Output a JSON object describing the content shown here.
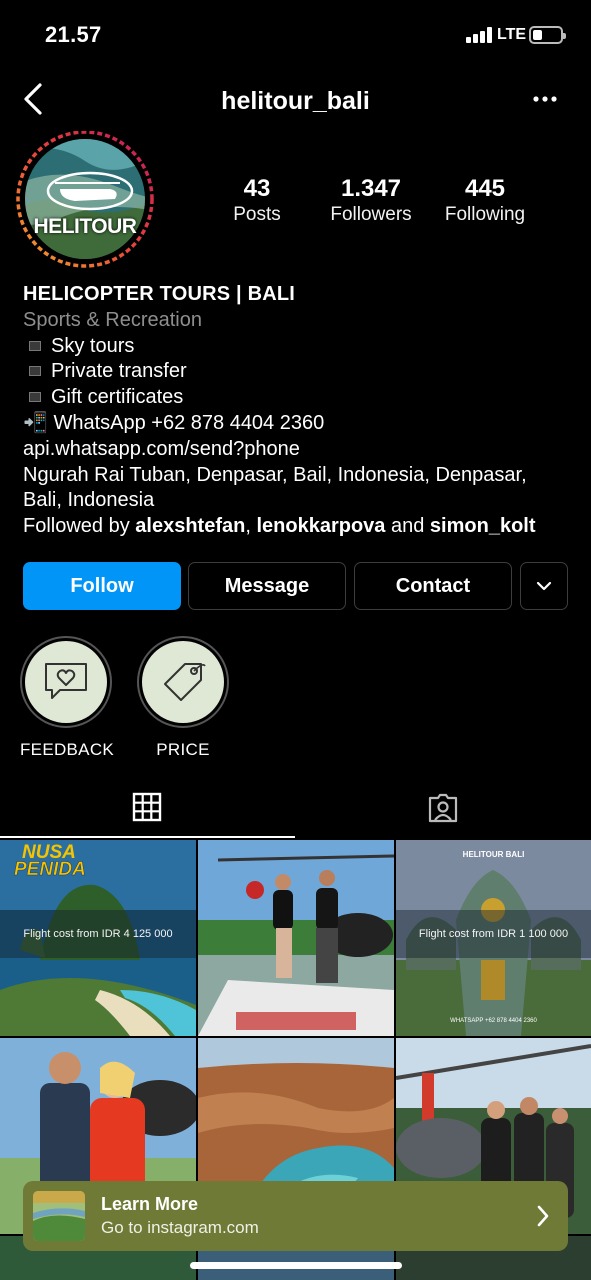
{
  "status_bar": {
    "time": "21.57",
    "network": "LTE"
  },
  "nav": {
    "title": "helitour_bali",
    "back_icon": "chevron-left-icon",
    "more_icon": "ellipsis-icon"
  },
  "profile": {
    "avatar_text": "HELITOUR",
    "stats": [
      {
        "value": "43",
        "label": "Posts"
      },
      {
        "value": "1.347",
        "label": "Followers"
      },
      {
        "value": "445",
        "label": "Following"
      }
    ],
    "name": "HELICOPTER TOURS | BALI",
    "category": "Sports & Recreation",
    "bullets": [
      "Sky tours",
      "Private transfer",
      "Gift certificates"
    ],
    "whatsapp": "📲 WhatsApp +62 878 4404 2360",
    "link": "api.whatsapp.com/send?phone",
    "address_1": "Ngurah Rai Tuban, Denpasar, Bail, Indonesia, Denpasar,",
    "address_2": "Bali, Indonesia",
    "followed_by_prefix": "Followed by",
    "followed_by": [
      "alexshtefan",
      "lenokkarpova",
      "simon_kolt"
    ],
    "followed_by_sep": ",",
    "followed_by_and": "and"
  },
  "actions": {
    "follow": "Follow",
    "message": "Message",
    "contact": "Contact"
  },
  "highlights": [
    {
      "label": "FEEDBACK",
      "icon": "chat-heart-icon"
    },
    {
      "label": "PRICE",
      "icon": "price-tag-icon"
    }
  ],
  "tabs": [
    {
      "icon": "grid-icon",
      "active": true
    },
    {
      "icon": "tagged-person-icon",
      "active": false
    }
  ],
  "posts": [
    {
      "title_1": "NUSA",
      "title_2": "PENIDA",
      "caption": "Flight cost from IDR 4 125 000"
    },
    {
      "caption": ""
    },
    {
      "title_1": "HELITOUR BALI",
      "caption": "Flight cost from IDR 1 100 000",
      "footer": "WHATSAPP +62 878 4404 2360"
    },
    {
      "caption": ""
    },
    {
      "caption": ""
    },
    {
      "caption": ""
    }
  ],
  "banner": {
    "title": "Learn More",
    "subtitle": "Go to instagram.com"
  },
  "colors": {
    "follow_blue": "#0095f6",
    "banner_olive": "#6f7a36",
    "story_ring": "#d6245f"
  }
}
